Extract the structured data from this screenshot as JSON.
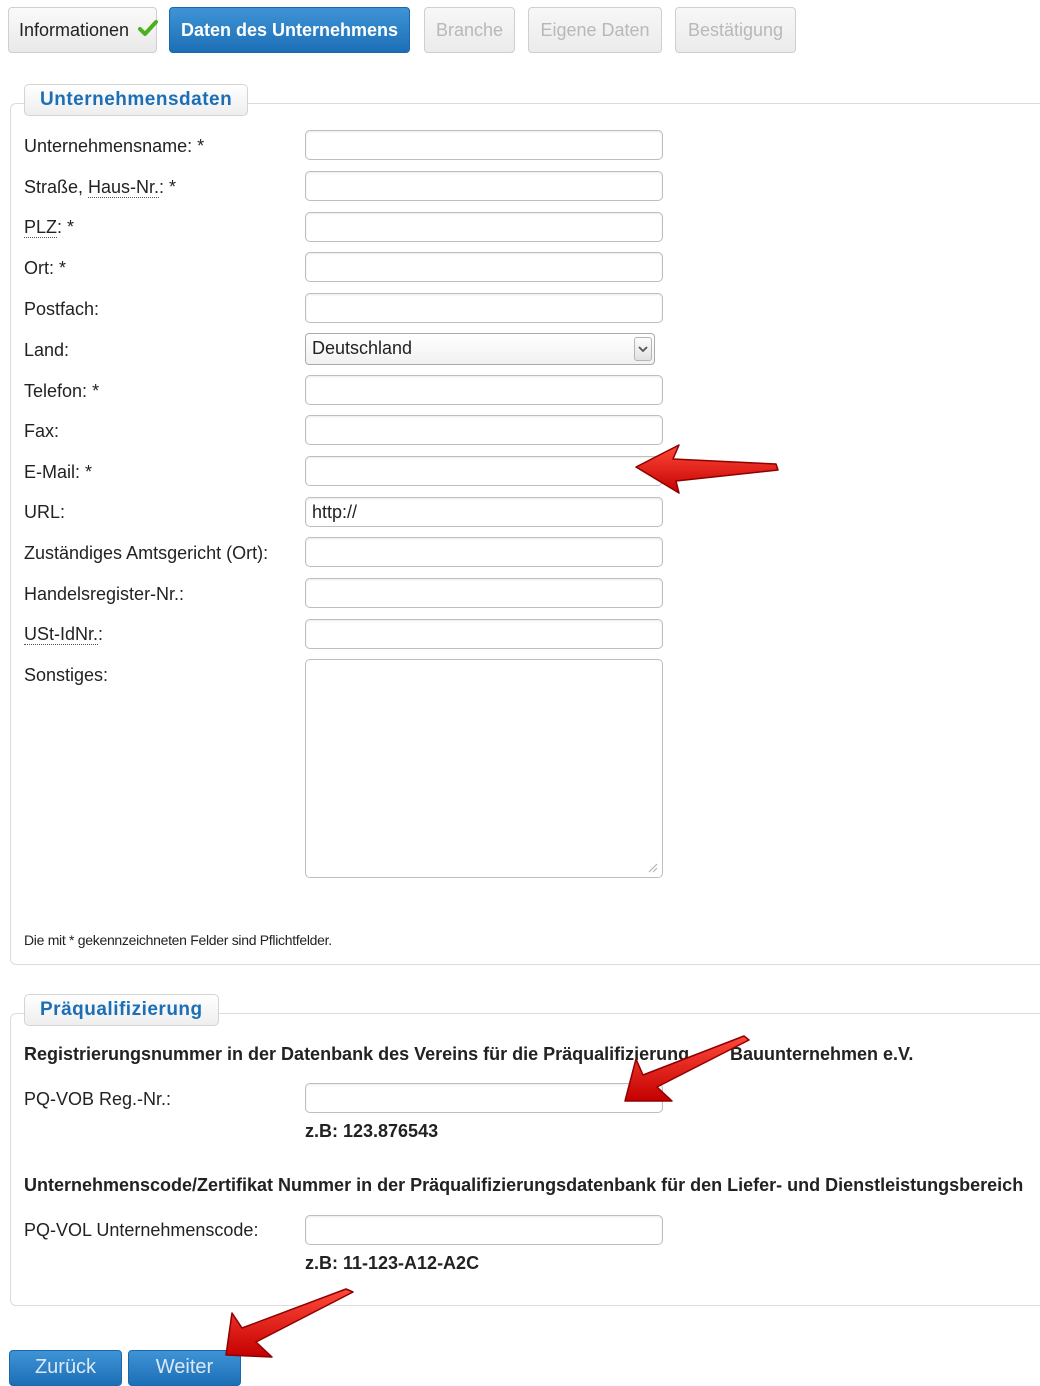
{
  "tabs": [
    {
      "label": "Informationen",
      "state": "done"
    },
    {
      "label": "Daten des Unternehmens",
      "state": "active"
    },
    {
      "label": "Branche",
      "state": "disabled"
    },
    {
      "label": "Eigene Daten",
      "state": "disabled"
    },
    {
      "label": "Bestätigung",
      "state": "disabled"
    }
  ],
  "company": {
    "legend": "Unternehmensdaten",
    "fields": {
      "name": {
        "label": "Unternehmensname:",
        "required": "*",
        "value": ""
      },
      "street": {
        "label_a": "Straße, ",
        "label_abbr": "Haus-Nr.",
        "label_b": ": *",
        "value": ""
      },
      "zip": {
        "label_abbr": "PLZ",
        "label_b": ": *",
        "value": ""
      },
      "city": {
        "label": "Ort:",
        "required": "*",
        "value": ""
      },
      "pobox": {
        "label": "Postfach:",
        "value": ""
      },
      "country": {
        "label": "Land:",
        "selected": "Deutschland"
      },
      "phone": {
        "label": "Telefon:",
        "required": "*",
        "value": ""
      },
      "fax": {
        "label": "Fax:",
        "value": ""
      },
      "email": {
        "label": "E-Mail:",
        "required": "*",
        "value": ""
      },
      "url": {
        "label": "URL:",
        "value": "http://"
      },
      "court": {
        "label": "Zuständiges Amtsgericht (Ort):",
        "value": ""
      },
      "register": {
        "label": "Handelsregister-Nr.:",
        "value": ""
      },
      "vat": {
        "label_abbr": "USt-IdNr.",
        "label_b": ":",
        "value": ""
      },
      "misc": {
        "label": "Sonstiges:",
        "value": ""
      }
    },
    "required_note": "Die mit * gekennzeichneten Felder sind Pflichtfelder."
  },
  "prequal": {
    "legend": "Präqualifizierung",
    "vob_heading_a": "Registrierungsnummer in der Datenbank des Vereins für die Präqualifizierung",
    "vob_heading_b": "Bauunternehmen e.V.",
    "vob_label": "PQ-VOB Reg.-Nr.:",
    "vob_value": "",
    "vob_example": "z.B: 123.876543",
    "vol_heading": "Unternehmenscode/Zertifikat Nummer in der Präqualifizierungsdatenbank für den Liefer- und Dienstleistungsbereich",
    "vol_label": "PQ-VOL Unternehmenscode:",
    "vol_value": "",
    "vol_example": "z.B: 11-123-A12-A2C"
  },
  "buttons": {
    "back": "Zurück",
    "next": "Weiter"
  },
  "colors": {
    "accent": "#1c6fb6",
    "check": "#4caf1e",
    "arrow": "#e01010"
  }
}
